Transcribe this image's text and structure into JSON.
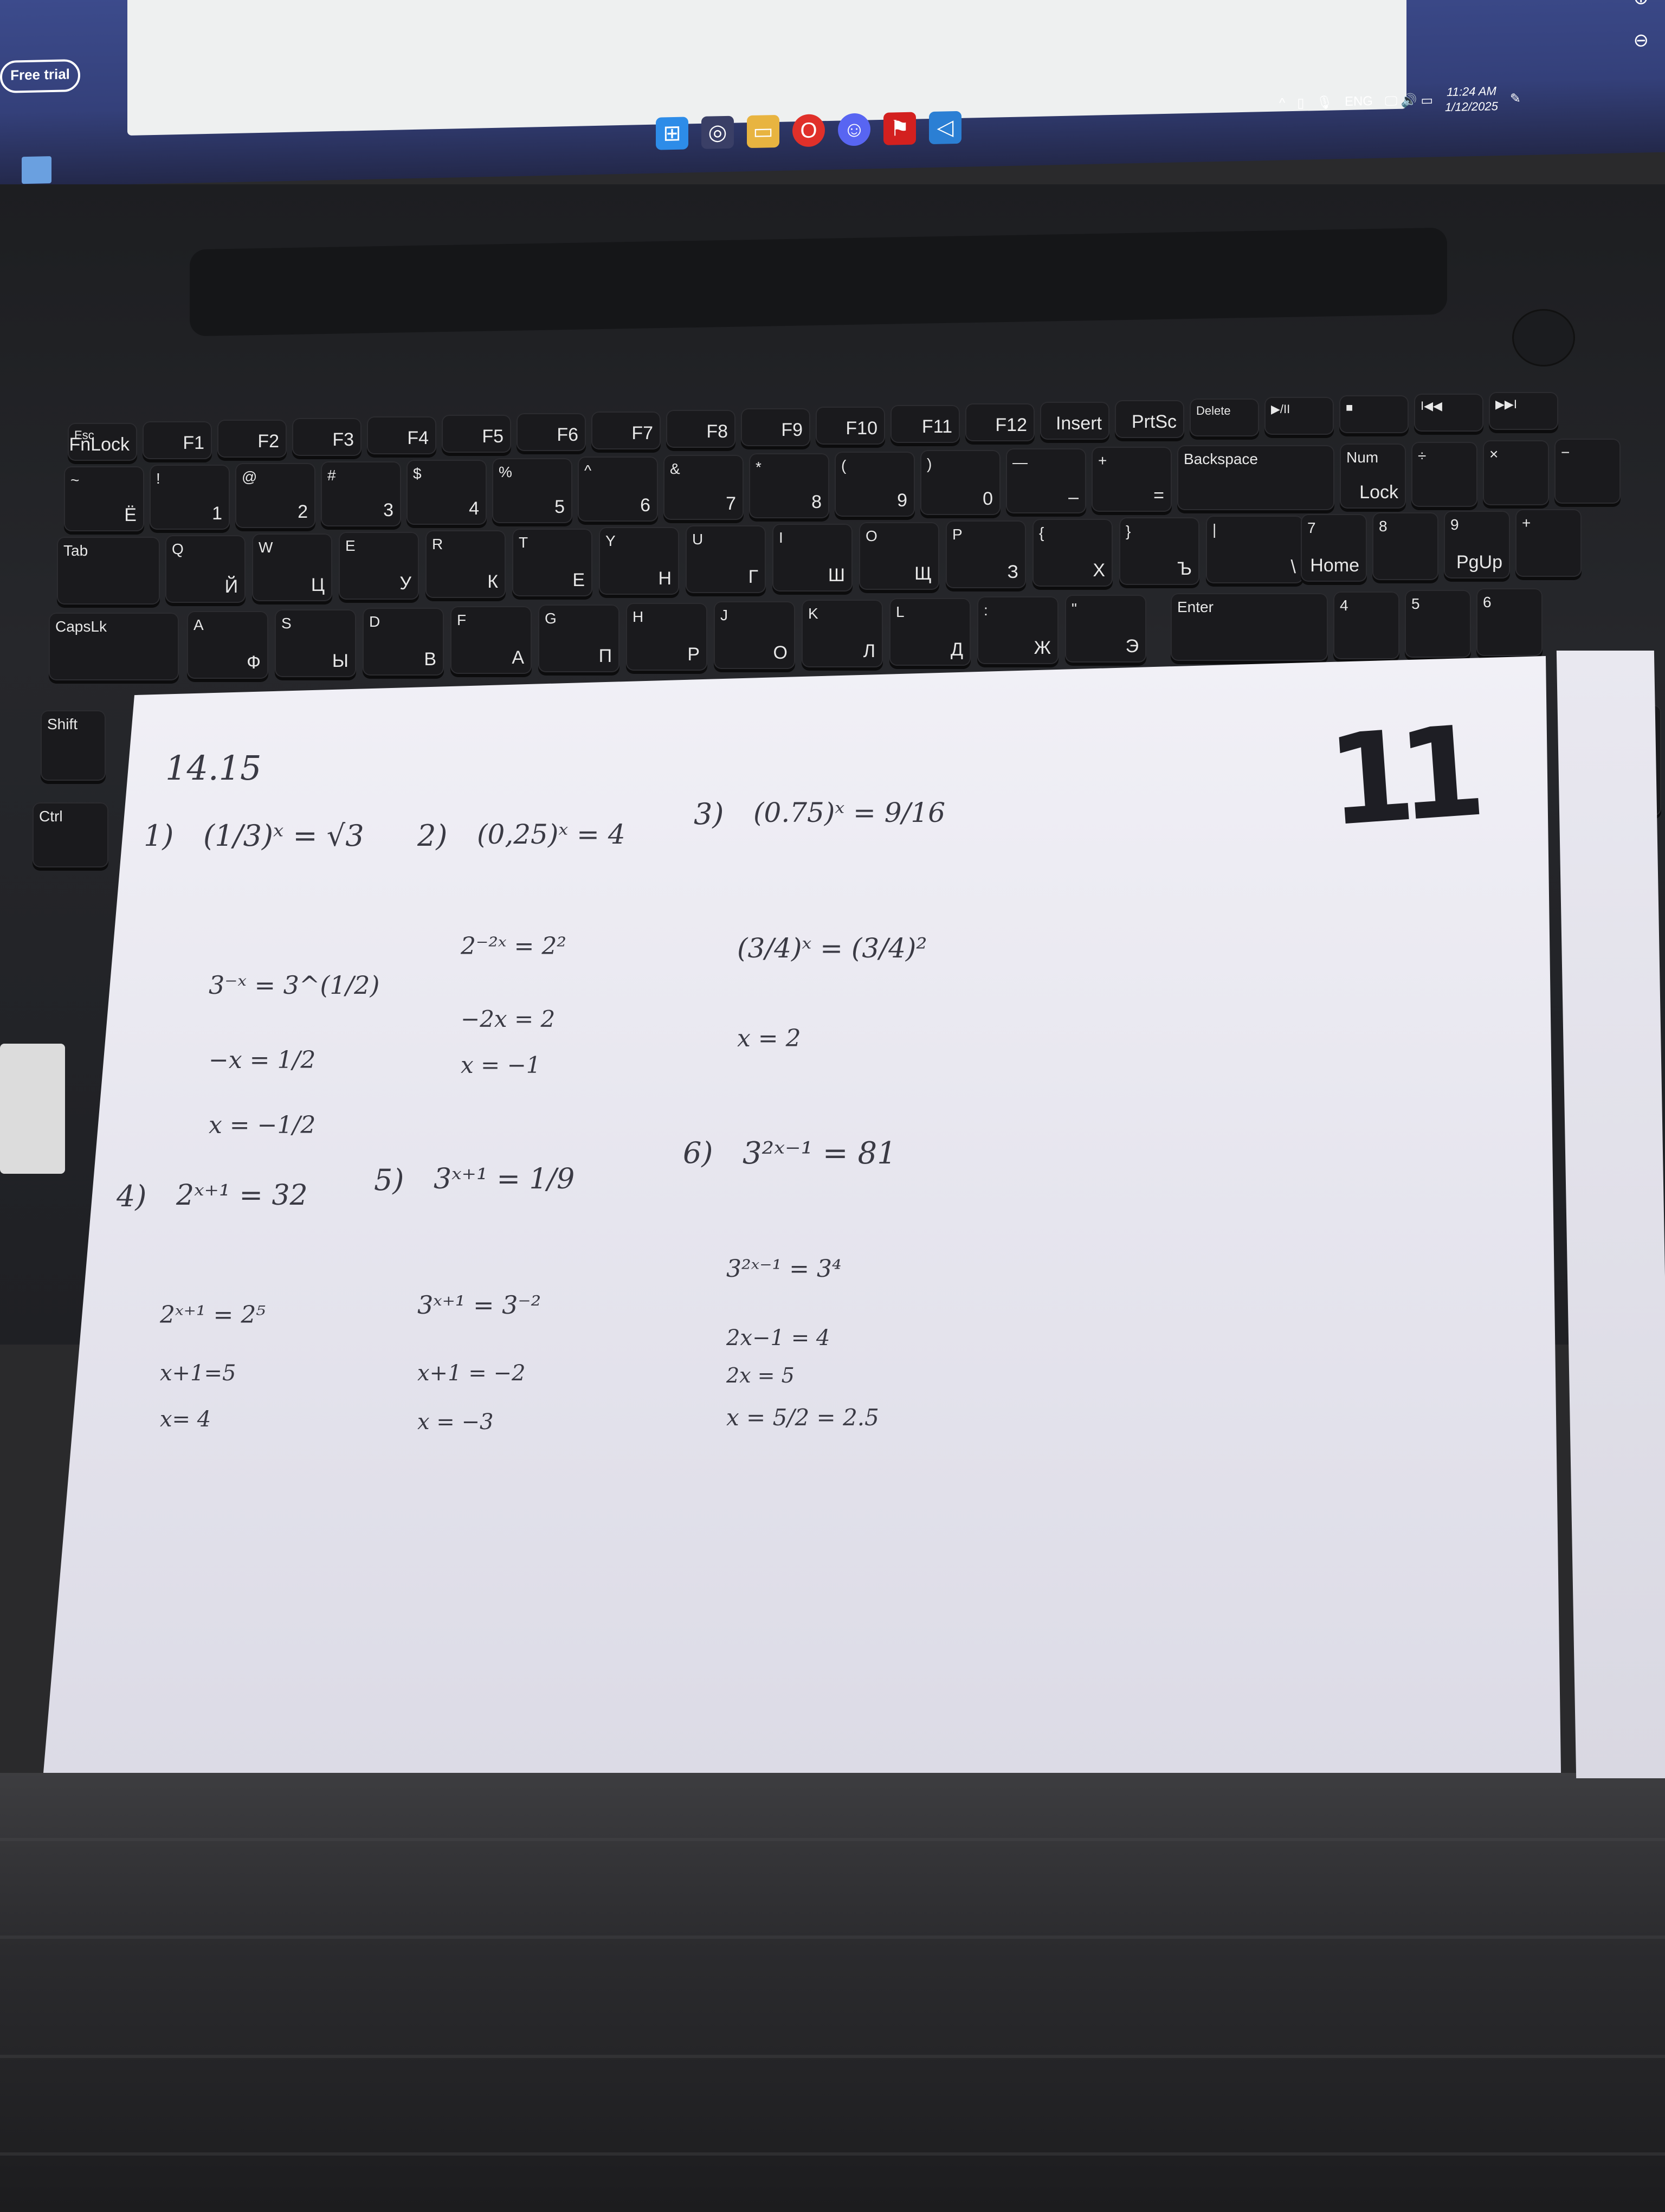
{
  "screen": {
    "free_trial_label": "Free trial",
    "taskbar_icons": [
      "windows-start-icon",
      "chrome-icon",
      "file-explorer-icon",
      "opera-icon",
      "discord-icon",
      "acrobat-icon",
      "vscode-icon"
    ],
    "tray": {
      "language": "ENG",
      "time": "11:24 AM",
      "date": "1/12/2025"
    }
  },
  "keyboard": {
    "function_row": [
      {
        "main": "Esc",
        "sub": "FnLock"
      },
      {
        "main": "",
        "sub": "F1"
      },
      {
        "main": "",
        "sub": "F2"
      },
      {
        "main": "",
        "sub": "F3"
      },
      {
        "main": "",
        "sub": "F4"
      },
      {
        "main": "",
        "sub": "F5"
      },
      {
        "main": "",
        "sub": "F6"
      },
      {
        "main": "",
        "sub": "F7"
      },
      {
        "main": "",
        "sub": "F8"
      },
      {
        "main": "",
        "sub": "F9"
      },
      {
        "main": "",
        "sub": "F10"
      },
      {
        "main": "",
        "sub": "F11"
      },
      {
        "main": "",
        "sub": "F12"
      },
      {
        "main": "",
        "sub": "Insert"
      },
      {
        "main": "",
        "sub": "PrtSc"
      },
      {
        "main": "Delete",
        "sub": ""
      },
      {
        "main": "▶/II",
        "sub": ""
      },
      {
        "main": "■",
        "sub": ""
      },
      {
        "main": "I◀◀",
        "sub": ""
      },
      {
        "main": "▶▶I",
        "sub": ""
      }
    ],
    "number_row": [
      {
        "top": "~",
        "bottom": "Ё"
      },
      {
        "top": "!",
        "bottom": "1"
      },
      {
        "top": "@",
        "bottom": "2"
      },
      {
        "top": "#",
        "bottom": "3"
      },
      {
        "top": "$",
        "bottom": "4"
      },
      {
        "top": "%",
        "bottom": "5"
      },
      {
        "top": "^",
        "bottom": "6"
      },
      {
        "top": "&",
        "bottom": "7"
      },
      {
        "top": "*",
        "bottom": "8"
      },
      {
        "top": "(",
        "bottom": "9"
      },
      {
        "top": ")",
        "bottom": "0"
      },
      {
        "top": "—",
        "bottom": "–"
      },
      {
        "top": "+",
        "bottom": "="
      },
      {
        "top": "Backspace",
        "bottom": ""
      },
      {
        "top": "Num",
        "bottom": "Lock"
      },
      {
        "top": "÷",
        "bottom": ""
      },
      {
        "top": "×",
        "bottom": ""
      },
      {
        "top": "−",
        "bottom": ""
      }
    ],
    "row_tab": [
      {
        "top": "Tab",
        "bottom": ""
      },
      {
        "top": "Q",
        "bottom": "Й"
      },
      {
        "top": "W",
        "bottom": "Ц"
      },
      {
        "top": "E",
        "bottom": "У"
      },
      {
        "top": "R",
        "bottom": "К"
      },
      {
        "top": "T",
        "bottom": "Е"
      },
      {
        "top": "Y",
        "bottom": "Н"
      },
      {
        "top": "U",
        "bottom": "Г"
      },
      {
        "top": "I",
        "bottom": "Ш"
      },
      {
        "top": "O",
        "bottom": "Щ"
      },
      {
        "top": "P",
        "bottom": "З"
      },
      {
        "top": "{",
        "bottom": "Х"
      },
      {
        "top": "}",
        "bottom": "Ъ"
      },
      {
        "top": "|",
        "bottom": "\\"
      },
      {
        "top": "7",
        "bottom": "Home"
      },
      {
        "top": "8",
        "bottom": ""
      },
      {
        "top": "9",
        "bottom": "PgUp"
      },
      {
        "top": "+",
        "bottom": ""
      }
    ],
    "row_caps": [
      {
        "top": "CapsLk",
        "bottom": ""
      },
      {
        "top": "A",
        "bottom": "Ф"
      },
      {
        "top": "S",
        "bottom": "Ы"
      },
      {
        "top": "D",
        "bottom": "В"
      },
      {
        "top": "F",
        "bottom": "А"
      },
      {
        "top": "G",
        "bottom": "П"
      },
      {
        "top": "H",
        "bottom": "Р"
      },
      {
        "top": "J",
        "bottom": "О"
      },
      {
        "top": "K",
        "bottom": "Л"
      },
      {
        "top": "L",
        "bottom": "Д"
      },
      {
        "top": ":",
        "bottom": "Ж"
      },
      {
        "top": "\"",
        "bottom": "Э"
      },
      {
        "top": "Enter",
        "bottom": ""
      },
      {
        "top": "4",
        "bottom": ""
      },
      {
        "top": "5",
        "bottom": ""
      },
      {
        "top": "6",
        "bottom": ""
      }
    ],
    "side_keys": {
      "shift": "Shift",
      "ctrl": "Ctrl",
      "enter_right": "Enter"
    }
  },
  "paper": {
    "heading": "14.15",
    "page_number": "11",
    "problems": [
      {
        "label": "1)",
        "lines": [
          "(1/3)ˣ = √3",
          "3⁻ˣ = 3^(1/2)",
          "−x = 1/2",
          "x = −1/2"
        ]
      },
      {
        "label": "2)",
        "lines": [
          "(0,25)ˣ = 4",
          "2⁻²ˣ = 2²",
          "−2x = 2",
          "x = −1"
        ]
      },
      {
        "label": "3)",
        "lines": [
          "(0.75)ˣ = 9/16",
          "(3/4)ˣ = (3/4)²",
          "x = 2"
        ]
      },
      {
        "label": "4)",
        "lines": [
          "2ˣ⁺¹ = 32",
          "2ˣ⁺¹ = 2⁵",
          "x+1=5",
          "x= 4"
        ]
      },
      {
        "label": "5)",
        "lines": [
          "3ˣ⁺¹ = 1/9",
          "3ˣ⁺¹ = 3⁻²",
          "x+1 = −2",
          "x = −3"
        ]
      },
      {
        "label": "6)",
        "lines": [
          "3²ˣ⁻¹ = 81",
          "3²ˣ⁻¹ = 3⁴",
          "2x−1 = 4",
          "2x = 5",
          "x = 5/2 = 2.5"
        ]
      }
    ]
  }
}
